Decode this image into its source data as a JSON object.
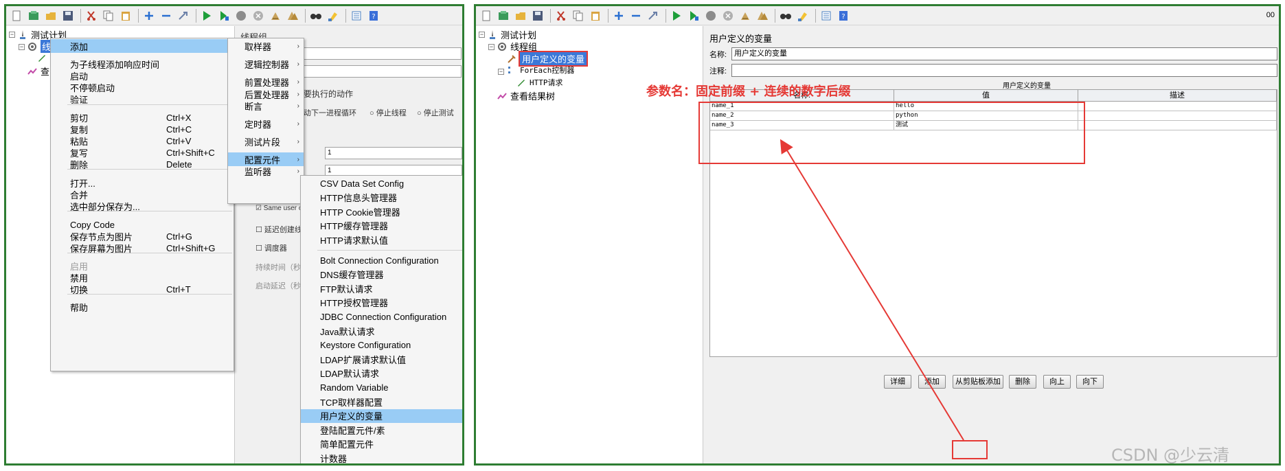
{
  "toolbar_icons": [
    "new-icon",
    "templates-icon",
    "open-icon",
    "save-icon",
    "cut-icon",
    "copy-icon",
    "paste-icon",
    "expand-icon",
    "collapse-icon",
    "toggle-icon",
    "start-icon",
    "start-no-pause-icon",
    "stop-icon",
    "shutdown-icon",
    "clear-icon",
    "clear-all-icon",
    "search-icon",
    "reset-search-icon",
    "function-helper-icon",
    "help-icon"
  ],
  "left": {
    "tree": {
      "root": "测试计划",
      "thread_group_partial": "线",
      "view_results_partial": "查"
    },
    "context_menu": {
      "items": [
        {
          "label": "添加",
          "shortcut": "",
          "submenu": true,
          "highlighted": true
        },
        {
          "label": "为子线程添加响应时间",
          "shortcut": ""
        },
        {
          "label": "启动",
          "shortcut": ""
        },
        {
          "label": "不停顿启动",
          "shortcut": ""
        },
        {
          "label": "验证",
          "shortcut": ""
        },
        {
          "label": "剪切",
          "shortcut": "Ctrl+X"
        },
        {
          "label": "复制",
          "shortcut": "Ctrl+C"
        },
        {
          "label": "粘贴",
          "shortcut": "Ctrl+V"
        },
        {
          "label": "复写",
          "shortcut": "Ctrl+Shift+C"
        },
        {
          "label": "删除",
          "shortcut": "Delete"
        },
        {
          "label": "打开...",
          "shortcut": ""
        },
        {
          "label": "合并",
          "shortcut": ""
        },
        {
          "label": "选中部分保存为...",
          "shortcut": ""
        },
        {
          "label": "Copy Code",
          "shortcut": ""
        },
        {
          "label": "保存节点为图片",
          "shortcut": "Ctrl+G"
        },
        {
          "label": "保存屏幕为图片",
          "shortcut": "Ctrl+Shift+G"
        },
        {
          "label": "启用",
          "shortcut": "",
          "disabled": true
        },
        {
          "label": "禁用",
          "shortcut": ""
        },
        {
          "label": "切换",
          "shortcut": "Ctrl+T"
        },
        {
          "label": "帮助",
          "shortcut": ""
        }
      ]
    },
    "add_submenu": {
      "items": [
        {
          "label": "取样器"
        },
        {
          "label": "逻辑控制器"
        },
        {
          "label": "前置处理器"
        },
        {
          "label": "后置处理器"
        },
        {
          "label": "断言"
        },
        {
          "label": "定时器"
        },
        {
          "label": "测试片段"
        },
        {
          "label": "配置元件",
          "highlighted": true
        },
        {
          "label": "监听器"
        }
      ]
    },
    "config_submenu": {
      "items": [
        "CSV Data Set Config",
        "HTTP信息头管理器",
        "HTTP Cookie管理器",
        "HTTP缓存管理器",
        "HTTP请求默认值",
        "Bolt Connection Configuration",
        "DNS缓存管理器",
        "FTP默认请求",
        "HTTP授权管理器",
        "JDBC Connection Configuration",
        "Java默认请求",
        "Keystore Configuration",
        "LDAP扩展请求默认值",
        "LDAP默认请求",
        "Random Variable",
        "TCP取样器配置",
        "用户定义的变量",
        "登陆配置元件/素",
        "简单配置元件",
        "计数器"
      ],
      "highlighted_index": 16
    },
    "background": {
      "panel_title": "线程组",
      "action_label": "要执行的动作",
      "radio_next_loop": "动下一进程循环",
      "radio_stop_thread": "停止线程",
      "radio_stop_test": "停止测试",
      "input_threads": "1",
      "input_loop": "1",
      "same_user": "Same user o",
      "delay_create": "延迟创建线程",
      "scheduler": "调度器",
      "duration": "持续时间（秒）",
      "startup_delay": "启动延迟（秒）"
    }
  },
  "right": {
    "toolbar_right_text": "00",
    "tree": {
      "root": "测试计划",
      "thread_group": "线程组",
      "user_vars": "用户定义的变量",
      "foreach": "ForEach控制器",
      "http_request": "HTTP请求",
      "view_results": "查看结果树"
    },
    "editor": {
      "title": "用户定义的变量",
      "name_label": "名称:",
      "name_value": "用户定义的变量",
      "comment_label": "注释:",
      "comment_value": "",
      "table_title": "用户定义的变量",
      "columns": [
        "名称:",
        "值",
        "描述"
      ],
      "rows": [
        {
          "name": "name_1",
          "value": "hello",
          "desc": ""
        },
        {
          "name": "name_2",
          "value": "python",
          "desc": ""
        },
        {
          "name": "name_3",
          "value": "测试",
          "desc": ""
        }
      ],
      "buttons": [
        "详细",
        "添加",
        "从剪贴板添加",
        "删除",
        "向上",
        "向下"
      ]
    },
    "annotation": "参数名：固定前缀 + 连续的数字后缀",
    "watermark": "CSDN @少云清"
  }
}
